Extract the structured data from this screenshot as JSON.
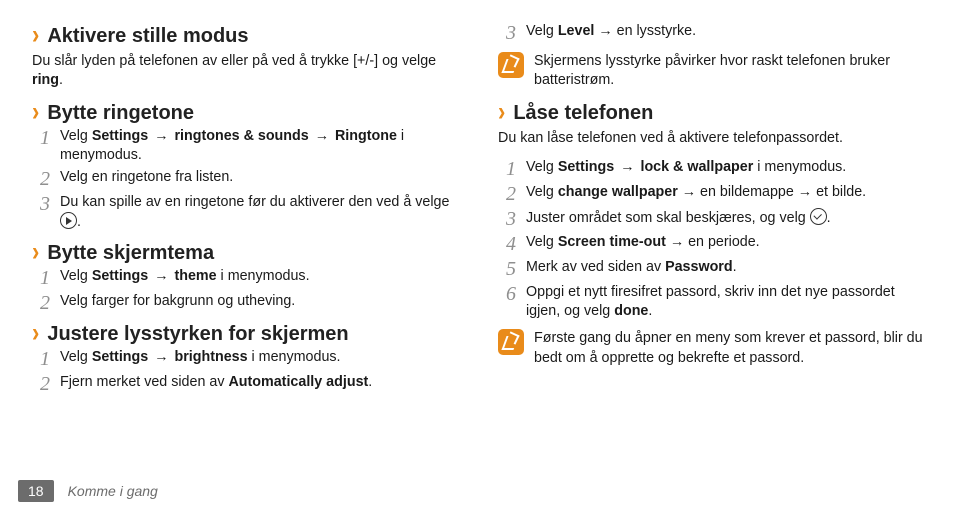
{
  "left": {
    "s1": {
      "title": "Aktivere stille modus",
      "para_pre": "Du slår lyden på telefonen av eller på ved å trykke [+/-] og velge ",
      "para_bold": "ring",
      "para_post": "."
    },
    "s2": {
      "title": "Bytte ringetone",
      "i1_a": "Velg ",
      "i1_b": "Settings",
      "i1_c": " → ",
      "i1_d": "ringtones & sounds",
      "i1_e": " → ",
      "i1_f": "Ringtone",
      "i1_g": " i menymodus.",
      "i2": "Velg en ringetone fra listen.",
      "i3_a": "Du kan spille av en ringetone før du aktiverer den ved å velge ",
      "i3_b": "."
    },
    "s3": {
      "title": "Bytte skjermtema",
      "i1_a": "Velg ",
      "i1_b": "Settings",
      "i1_c": " → ",
      "i1_d": "theme",
      "i1_e": " i menymodus.",
      "i2": "Velg farger for bakgrunn og utheving."
    },
    "s4": {
      "title": "Justere lysstyrken for skjermen",
      "i1_a": "Velg ",
      "i1_b": "Settings",
      "i1_c": " → ",
      "i1_d": "brightness",
      "i1_e": " i menymodus.",
      "i2_a": "Fjern merket ved siden av ",
      "i2_b": "Automatically adjust",
      "i2_c": "."
    }
  },
  "right": {
    "top": {
      "i3_a": "Velg ",
      "i3_b": "Level",
      "i3_c": " → en lysstyrke.",
      "note": "Skjermens lysstyrke påvirker hvor raskt telefonen bruker batteristrøm."
    },
    "s5": {
      "title": "Låse telefonen",
      "para": "Du kan låse telefonen ved å aktivere telefonpassordet.",
      "i1_a": "Velg ",
      "i1_b": "Settings",
      "i1_c": " → ",
      "i1_d": "lock & wallpaper",
      "i1_e": " i menymodus.",
      "i2_a": "Velg ",
      "i2_b": "change wallpaper",
      "i2_c": " → en bildemappe → et bilde.",
      "i3_a": "Juster området som skal beskjæres, og velg ",
      "i3_b": ".",
      "i4_a": "Velg ",
      "i4_b": "Screen time-out",
      "i4_c": " → en periode.",
      "i5_a": "Merk av ved siden av ",
      "i5_b": "Password",
      "i5_c": ".",
      "i6_a": "Oppgi et nytt firesifret passord, skriv inn det nye passordet igjen, og velg ",
      "i6_b": "done",
      "i6_c": ".",
      "note": "Første gang du åpner en meny som krever et passord, blir du bedt om å opprette og bekrefte et passord."
    }
  },
  "nums": {
    "n1": "1",
    "n2": "2",
    "n3": "3",
    "n4": "4",
    "n5": "5",
    "n6": "6"
  },
  "footer": {
    "page": "18",
    "section": "Komme i gang"
  }
}
